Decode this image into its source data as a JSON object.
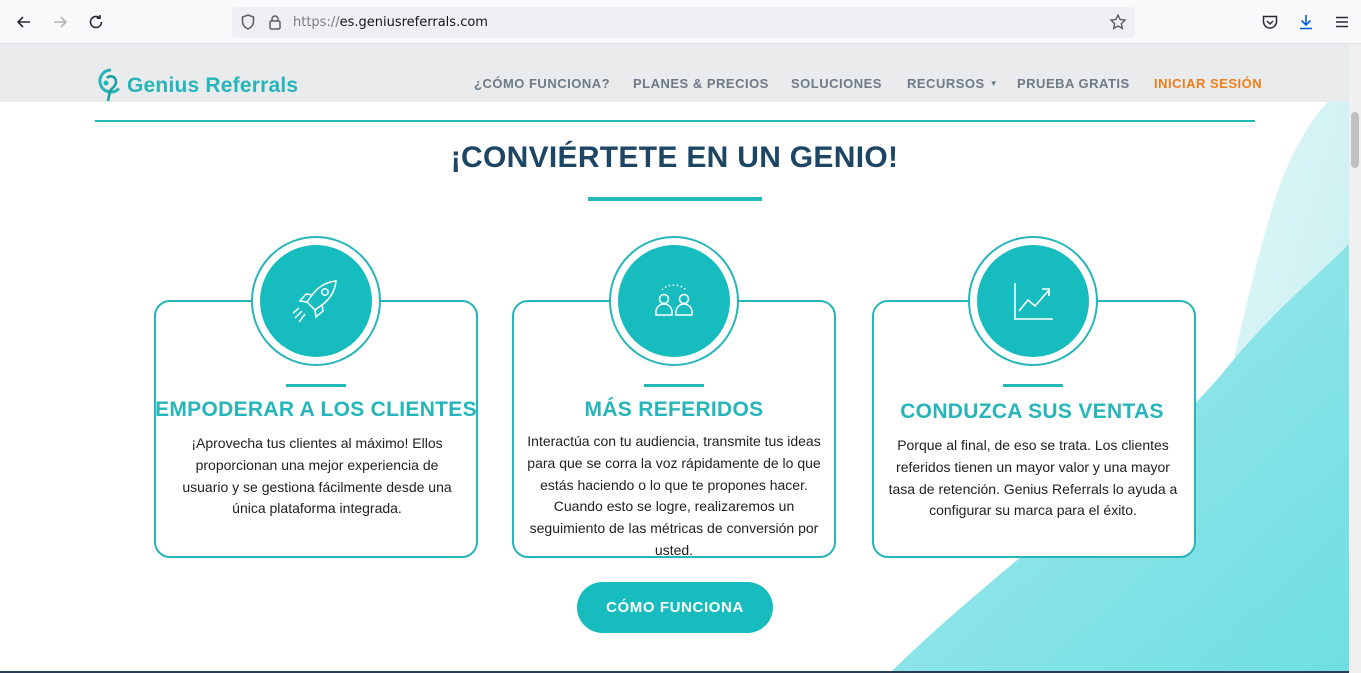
{
  "browser": {
    "url_scheme": "https://",
    "url_host": "es.geniusreferrals.com"
  },
  "site": {
    "logo_text": "Genius Referrals",
    "nav": [
      {
        "label": "¿CÓMO FUNCIONA?"
      },
      {
        "label": "PLANES & PRECIOS"
      },
      {
        "label": "SOLUCIONES"
      },
      {
        "label": "RECURSOS"
      },
      {
        "label": "PRUEBA GRATIS"
      },
      {
        "label": "INICIAR SESIÓN"
      }
    ]
  },
  "main": {
    "headline": "¡CONVIÉRTETE EN UN GENIO!",
    "cards": [
      {
        "icon": "rocket-icon",
        "title": "EMPODERAR A LOS CLIENTES",
        "text": "¡Aprovecha tus clientes al máximo! Ellos proporcionan una mejor experiencia de usuario y se gestiona fácilmente desde una única plataforma integrada."
      },
      {
        "icon": "people-icon",
        "title": "MÁS REFERIDOS",
        "text": "Interactúa con tu audiencia, transmite tus ideas para que se corra la voz rápidamente de lo que estás haciendo o lo que te propones hacer. Cuando esto se logre, realizaremos un seguimiento de las métricas de conversión por usted."
      },
      {
        "icon": "growth-chart-icon",
        "title": "CONDUZCA SUS VENTAS",
        "text": "Porque al final, de eso se trata. Los clientes referidos tienen un mayor valor y una mayor tasa de retención. Genius Referrals lo ayuda a configurar su marca para el éxito."
      }
    ],
    "cta_label": "CÓMO FUNCIONA"
  },
  "colors": {
    "teal": "#26b5b9",
    "teal_fill": "#17bcbf",
    "navy": "#1c4664",
    "accent_orange": "#ef7f1a",
    "menu_gray": "#6e7a86"
  }
}
